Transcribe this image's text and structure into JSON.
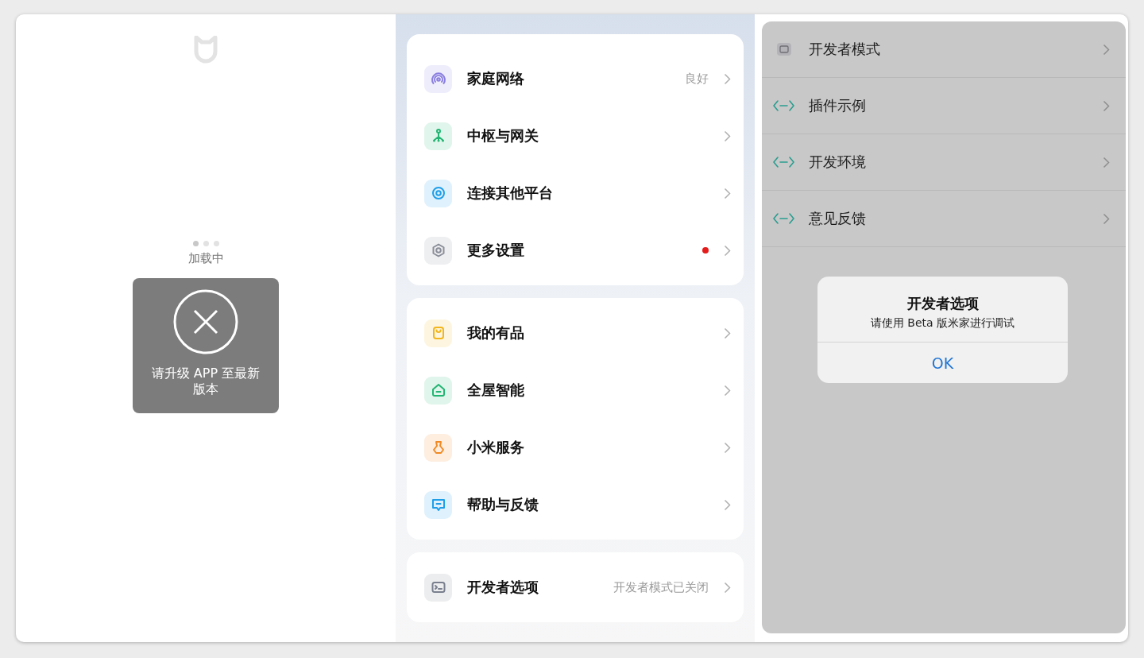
{
  "splash": {
    "loading_text": "加载中",
    "toast_message": "请升级 APP 至最新版本"
  },
  "settings": {
    "groups": [
      {
        "rows": [
          {
            "kind": "network",
            "color": "#8a7fe0",
            "label": "家庭网络",
            "value": "良好",
            "badge": false
          },
          {
            "kind": "hub",
            "color": "#22b573",
            "label": "中枢与网关",
            "badge": false
          },
          {
            "kind": "link",
            "color": "#1f9ee8",
            "label": "连接其他平台",
            "badge": false
          },
          {
            "kind": "settings",
            "color": "#8a8e99",
            "label": "更多设置",
            "badge": true
          }
        ]
      },
      {
        "rows": [
          {
            "kind": "bag",
            "color": "#f2b51c",
            "label": "我的有品",
            "badge": false
          },
          {
            "kind": "home",
            "color": "#22b573",
            "label": "全屋智能",
            "badge": false
          },
          {
            "kind": "service",
            "color": "#f08a24",
            "label": "小米服务",
            "badge": false
          },
          {
            "kind": "chat",
            "color": "#1f9ee8",
            "label": "帮助与反馈",
            "badge": false
          }
        ]
      },
      {
        "rows": [
          {
            "kind": "terminal",
            "color": "#7a7f8f",
            "label": "开发者选项",
            "value": "开发者模式已关闭",
            "badge": false
          }
        ]
      }
    ]
  },
  "developer": {
    "rows": [
      {
        "kind": "terminal",
        "label": "开发者模式"
      },
      {
        "kind": "code",
        "label": "插件示例"
      },
      {
        "kind": "code",
        "label": "开发环境"
      },
      {
        "kind": "code",
        "label": "意见反馈"
      }
    ],
    "dialog": {
      "title": "开发者选项",
      "message": "请使用 Beta 版米家进行调试",
      "button": "OK"
    }
  }
}
